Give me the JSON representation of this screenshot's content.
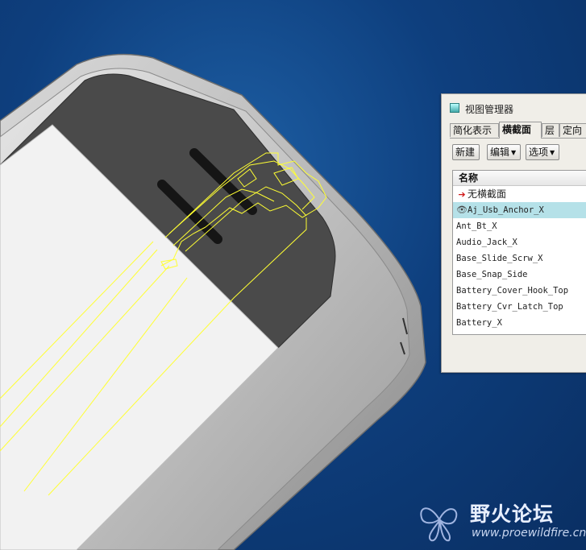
{
  "view_manager": {
    "title": "视图管理器",
    "tabs": [
      {
        "label": "简化表示",
        "active": false
      },
      {
        "label": "横截面",
        "active": true
      },
      {
        "label": "层",
        "active": false
      },
      {
        "label": "定向",
        "active": false
      }
    ],
    "toolbar": {
      "new_label": "新建",
      "edit_label": "编辑",
      "options_label": "选项"
    },
    "list": {
      "header": "名称",
      "items": [
        {
          "label": "无横截面",
          "icon": "red-arrow-icon",
          "selected": false
        },
        {
          "label": "Aj_Usb_Anchor_X",
          "icon": "eye-icon",
          "selected": true
        },
        {
          "label": "Ant_Bt_X",
          "icon": "",
          "selected": false
        },
        {
          "label": "Audio_Jack_X",
          "icon": "",
          "selected": false
        },
        {
          "label": "Base_Slide_Scrw_X",
          "icon": "",
          "selected": false
        },
        {
          "label": "Base_Snap_Side",
          "icon": "",
          "selected": false
        },
        {
          "label": "Battery_Cover_Hook_Top",
          "icon": "",
          "selected": false
        },
        {
          "label": "Battery_Cvr_Latch_Top",
          "icon": "",
          "selected": false
        },
        {
          "label": "Battery_X",
          "icon": "",
          "selected": false
        }
      ]
    }
  },
  "watermark": {
    "title": "野火论坛",
    "url": "www.proewildfire.cn"
  },
  "colors": {
    "background": "#0e3f7e",
    "section_outline": "#ffff33",
    "selected_row": "#b5e1e8",
    "panel": "#f0eee8"
  }
}
